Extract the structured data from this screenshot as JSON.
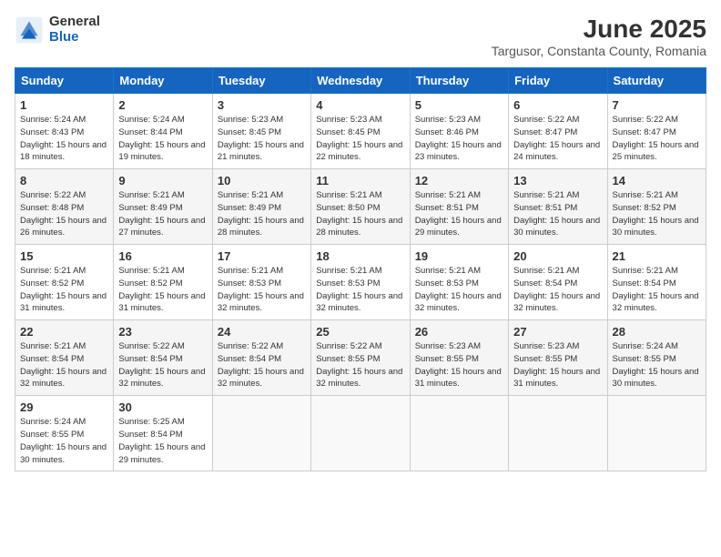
{
  "header": {
    "logo_general": "General",
    "logo_blue": "Blue",
    "month_year": "June 2025",
    "location": "Targusor, Constanta County, Romania"
  },
  "weekdays": [
    "Sunday",
    "Monday",
    "Tuesday",
    "Wednesday",
    "Thursday",
    "Friday",
    "Saturday"
  ],
  "weeks": [
    [
      {
        "day": "1",
        "sunrise": "Sunrise: 5:24 AM",
        "sunset": "Sunset: 8:43 PM",
        "daylight": "Daylight: 15 hours and 18 minutes."
      },
      {
        "day": "2",
        "sunrise": "Sunrise: 5:24 AM",
        "sunset": "Sunset: 8:44 PM",
        "daylight": "Daylight: 15 hours and 19 minutes."
      },
      {
        "day": "3",
        "sunrise": "Sunrise: 5:23 AM",
        "sunset": "Sunset: 8:45 PM",
        "daylight": "Daylight: 15 hours and 21 minutes."
      },
      {
        "day": "4",
        "sunrise": "Sunrise: 5:23 AM",
        "sunset": "Sunset: 8:45 PM",
        "daylight": "Daylight: 15 hours and 22 minutes."
      },
      {
        "day": "5",
        "sunrise": "Sunrise: 5:23 AM",
        "sunset": "Sunset: 8:46 PM",
        "daylight": "Daylight: 15 hours and 23 minutes."
      },
      {
        "day": "6",
        "sunrise": "Sunrise: 5:22 AM",
        "sunset": "Sunset: 8:47 PM",
        "daylight": "Daylight: 15 hours and 24 minutes."
      },
      {
        "day": "7",
        "sunrise": "Sunrise: 5:22 AM",
        "sunset": "Sunset: 8:47 PM",
        "daylight": "Daylight: 15 hours and 25 minutes."
      }
    ],
    [
      {
        "day": "8",
        "sunrise": "Sunrise: 5:22 AM",
        "sunset": "Sunset: 8:48 PM",
        "daylight": "Daylight: 15 hours and 26 minutes."
      },
      {
        "day": "9",
        "sunrise": "Sunrise: 5:21 AM",
        "sunset": "Sunset: 8:49 PM",
        "daylight": "Daylight: 15 hours and 27 minutes."
      },
      {
        "day": "10",
        "sunrise": "Sunrise: 5:21 AM",
        "sunset": "Sunset: 8:49 PM",
        "daylight": "Daylight: 15 hours and 28 minutes."
      },
      {
        "day": "11",
        "sunrise": "Sunrise: 5:21 AM",
        "sunset": "Sunset: 8:50 PM",
        "daylight": "Daylight: 15 hours and 28 minutes."
      },
      {
        "day": "12",
        "sunrise": "Sunrise: 5:21 AM",
        "sunset": "Sunset: 8:51 PM",
        "daylight": "Daylight: 15 hours and 29 minutes."
      },
      {
        "day": "13",
        "sunrise": "Sunrise: 5:21 AM",
        "sunset": "Sunset: 8:51 PM",
        "daylight": "Daylight: 15 hours and 30 minutes."
      },
      {
        "day": "14",
        "sunrise": "Sunrise: 5:21 AM",
        "sunset": "Sunset: 8:52 PM",
        "daylight": "Daylight: 15 hours and 30 minutes."
      }
    ],
    [
      {
        "day": "15",
        "sunrise": "Sunrise: 5:21 AM",
        "sunset": "Sunset: 8:52 PM",
        "daylight": "Daylight: 15 hours and 31 minutes."
      },
      {
        "day": "16",
        "sunrise": "Sunrise: 5:21 AM",
        "sunset": "Sunset: 8:52 PM",
        "daylight": "Daylight: 15 hours and 31 minutes."
      },
      {
        "day": "17",
        "sunrise": "Sunrise: 5:21 AM",
        "sunset": "Sunset: 8:53 PM",
        "daylight": "Daylight: 15 hours and 32 minutes."
      },
      {
        "day": "18",
        "sunrise": "Sunrise: 5:21 AM",
        "sunset": "Sunset: 8:53 PM",
        "daylight": "Daylight: 15 hours and 32 minutes."
      },
      {
        "day": "19",
        "sunrise": "Sunrise: 5:21 AM",
        "sunset": "Sunset: 8:53 PM",
        "daylight": "Daylight: 15 hours and 32 minutes."
      },
      {
        "day": "20",
        "sunrise": "Sunrise: 5:21 AM",
        "sunset": "Sunset: 8:54 PM",
        "daylight": "Daylight: 15 hours and 32 minutes."
      },
      {
        "day": "21",
        "sunrise": "Sunrise: 5:21 AM",
        "sunset": "Sunset: 8:54 PM",
        "daylight": "Daylight: 15 hours and 32 minutes."
      }
    ],
    [
      {
        "day": "22",
        "sunrise": "Sunrise: 5:21 AM",
        "sunset": "Sunset: 8:54 PM",
        "daylight": "Daylight: 15 hours and 32 minutes."
      },
      {
        "day": "23",
        "sunrise": "Sunrise: 5:22 AM",
        "sunset": "Sunset: 8:54 PM",
        "daylight": "Daylight: 15 hours and 32 minutes."
      },
      {
        "day": "24",
        "sunrise": "Sunrise: 5:22 AM",
        "sunset": "Sunset: 8:54 PM",
        "daylight": "Daylight: 15 hours and 32 minutes."
      },
      {
        "day": "25",
        "sunrise": "Sunrise: 5:22 AM",
        "sunset": "Sunset: 8:55 PM",
        "daylight": "Daylight: 15 hours and 32 minutes."
      },
      {
        "day": "26",
        "sunrise": "Sunrise: 5:23 AM",
        "sunset": "Sunset: 8:55 PM",
        "daylight": "Daylight: 15 hours and 31 minutes."
      },
      {
        "day": "27",
        "sunrise": "Sunrise: 5:23 AM",
        "sunset": "Sunset: 8:55 PM",
        "daylight": "Daylight: 15 hours and 31 minutes."
      },
      {
        "day": "28",
        "sunrise": "Sunrise: 5:24 AM",
        "sunset": "Sunset: 8:55 PM",
        "daylight": "Daylight: 15 hours and 30 minutes."
      }
    ],
    [
      {
        "day": "29",
        "sunrise": "Sunrise: 5:24 AM",
        "sunset": "Sunset: 8:55 PM",
        "daylight": "Daylight: 15 hours and 30 minutes."
      },
      {
        "day": "30",
        "sunrise": "Sunrise: 5:25 AM",
        "sunset": "Sunset: 8:54 PM",
        "daylight": "Daylight: 15 hours and 29 minutes."
      },
      null,
      null,
      null,
      null,
      null
    ]
  ]
}
